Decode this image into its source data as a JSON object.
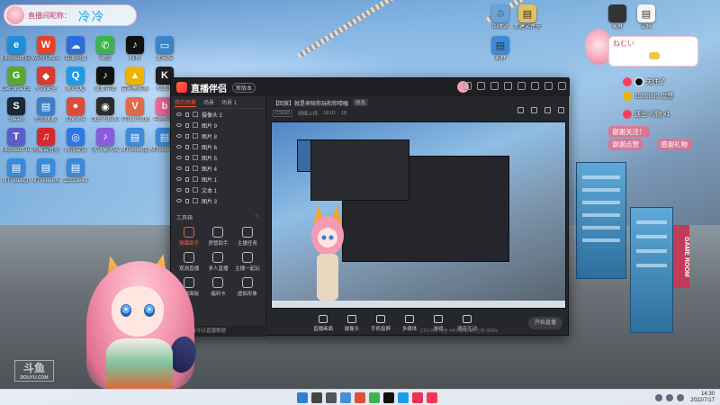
{
  "user_pill": {
    "name": "直播间昵称：",
    "display": "冷冷"
  },
  "desktop_icons": [
    {
      "label": "Microsoft Edge",
      "glyph": "e",
      "color": "#1d8fd6"
    },
    {
      "label": "WPS Office",
      "glyph": "W",
      "color": "#e8402a"
    },
    {
      "label": "百度网盘",
      "glyph": "☁",
      "color": "#2b6cdb"
    },
    {
      "label": "微信",
      "glyph": "✆",
      "color": "#3bb54a"
    },
    {
      "label": "抖音",
      "glyph": "♪",
      "color": "#111111"
    },
    {
      "label": "此电脑",
      "glyph": "▭",
      "color": "#3a84c9"
    },
    {
      "label": "GeForce Experience",
      "glyph": "G",
      "color": "#58a82e"
    },
    {
      "label": "火绒安全",
      "glyph": "◆",
      "color": "#d9392e"
    },
    {
      "label": "腾讯QQ",
      "glyph": "Q",
      "color": "#1e9be8"
    },
    {
      "label": "直播伴侣",
      "glyph": "♪",
      "color": "#111111"
    },
    {
      "label": "雷电模拟器",
      "glyph": "▲",
      "color": "#f0b400"
    },
    {
      "label": "KOOK",
      "glyph": "K",
      "color": "#202020"
    },
    {
      "label": "Steam",
      "glyph": "S",
      "color": "#1b2838"
    },
    {
      "label": "控制面板",
      "glyph": "▤",
      "color": "#3d7fc4"
    },
    {
      "label": "Chrome",
      "glyph": "●",
      "color": "#dd4b39"
    },
    {
      "label": "OBS Studio",
      "glyph": "◉",
      "color": "#2b2b2b"
    },
    {
      "label": "VTube Studio",
      "glyph": "V",
      "color": "#e06a4a"
    },
    {
      "label": "哔哩哔哩",
      "glyph": "b",
      "color": "#f0669a"
    },
    {
      "label": "Microsoft Teams",
      "glyph": "T",
      "color": "#5a5fc7"
    },
    {
      "label": "网易云音乐",
      "glyph": "♫",
      "color": "#d7292b"
    },
    {
      "label": "腾讯会议",
      "glyph": "◎",
      "color": "#2a78e4"
    },
    {
      "label": "讯飞输入法",
      "glyph": "♪",
      "color": "#8a5ae0"
    },
    {
      "label": "MTVideo(1)",
      "glyph": "▤",
      "color": "#3c8ad8"
    },
    {
      "label": "MTVideo(2)",
      "glyph": "▤",
      "color": "#3c8ad8"
    },
    {
      "label": "MTVideo(3)",
      "glyph": "▤",
      "color": "#3c8ad8"
    },
    {
      "label": "MTVideo(4)",
      "glyph": "▤",
      "color": "#3c8ad8"
    },
    {
      "label": "22c23e4b",
      "glyph": "▤",
      "color": "#3c8ad8"
    }
  ],
  "right_desktop_icons": [
    {
      "label": "回收站",
      "glyph": "♲",
      "color": "#6aa3d8"
    },
    {
      "label": "新建文件夹",
      "glyph": "▤",
      "color": "#e4c05a"
    },
    {
      "label": "素材",
      "glyph": "▤",
      "color": "#3c8ad8"
    },
    {
      "label": "录屏",
      "glyph": "▶",
      "color": "#333333"
    },
    {
      "label": "文档",
      "glyph": "▤",
      "color": "#f5f5f5"
    }
  ],
  "app": {
    "title": "直播伴侣",
    "version": "新版本",
    "left_tabs": [
      "我的场景",
      "场景",
      "场景 1"
    ],
    "layers": [
      "摄像头 2",
      "图片 9",
      "图片 8",
      "图片 6",
      "图片 5",
      "图片 4",
      "图片 1",
      "文本 1",
      "图片 3"
    ],
    "tools_title": "工具箱",
    "tools": [
      {
        "label": "弹幕助手",
        "hot": true
      },
      {
        "label": "房管助手",
        "hot": false
      },
      {
        "label": "主播任务",
        "hot": false
      },
      {
        "label": "观测直播",
        "hot": false
      },
      {
        "label": "多人直播",
        "hot": false
      },
      {
        "label": "主播一起玩",
        "hot": false
      },
      {
        "label": "特效面板",
        "hot": false
      },
      {
        "label": "福利卡",
        "hot": false
      },
      {
        "label": "虚拟形象",
        "hot": false
      }
    ],
    "left_footer": "点击查看今日直播数据",
    "stream_title": "【回放】就是来陪你玩和你唠嗑",
    "stream_badge": "修改",
    "stream_meta": [
      "CSGO",
      "网络上传",
      "18:01",
      "18"
    ],
    "controls": [
      "直播画面",
      "摄像头",
      "手机投屏",
      "多媒体",
      "游戏",
      "语音互动"
    ],
    "go_live": "开始直播",
    "status": "CPU 8%  内存 44%  帧率 60  上传 0KB/s"
  },
  "chat": {
    "header": "ねむい",
    "rows": [
      {
        "text": "关注了"
      },
      {
        "text": "1000000 点赞"
      },
      {
        "text": "送出 礼物 x1"
      }
    ],
    "bubbles": [
      "谢谢关注！",
      "谢谢点赞",
      "感谢礼物"
    ]
  },
  "watermark": {
    "big": "斗鱼",
    "small": "DOUYU.COM"
  },
  "taskbar": {
    "time": "14:30",
    "date": "2022/7/17",
    "pinned": [
      {
        "name": "start",
        "color": "#2d7fd6"
      },
      {
        "name": "search",
        "color": "#444444"
      },
      {
        "name": "taskview",
        "color": "#555555"
      },
      {
        "name": "widgets",
        "color": "#4a8cd6"
      },
      {
        "name": "chrome",
        "color": "#e0513a"
      },
      {
        "name": "wechat",
        "color": "#3bb54a"
      },
      {
        "name": "douyin",
        "color": "#111111"
      },
      {
        "name": "qq",
        "color": "#1e9be8"
      },
      {
        "name": "kook",
        "color": "#e63257"
      },
      {
        "name": "livecompanion",
        "color": "#ff3355"
      }
    ]
  },
  "colors": {
    "accent": "#ff5a3c",
    "app_bg": "#26272c",
    "chat_pink": "#e66e8c"
  }
}
